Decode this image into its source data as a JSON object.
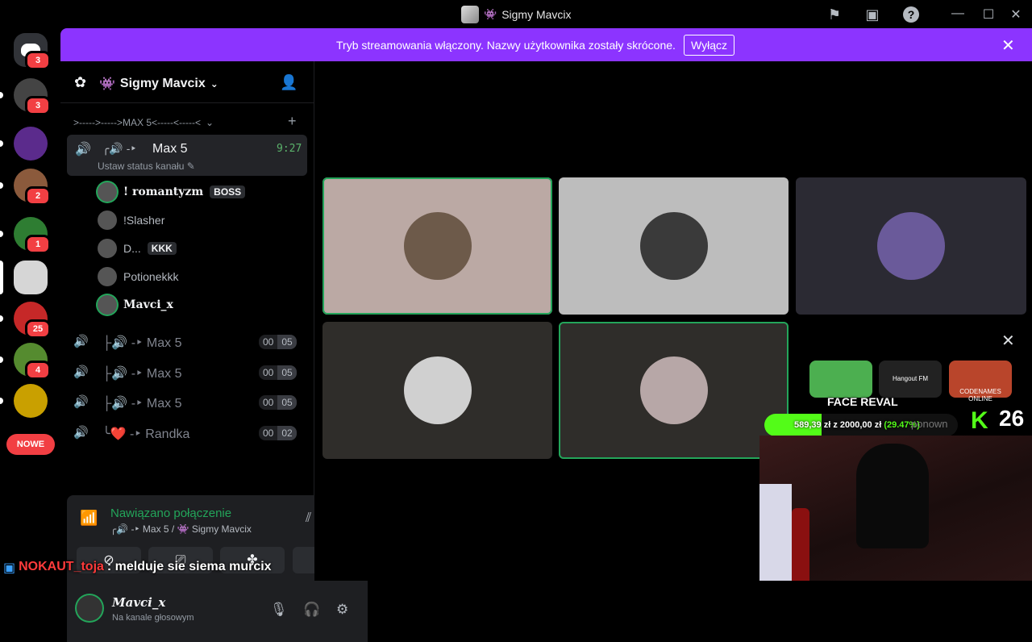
{
  "window": {
    "title": "Sigmy Mavcix",
    "title_emoji": "👾",
    "controls": [
      "—",
      "☐",
      "✕"
    ]
  },
  "rail": {
    "servers": [
      {
        "name": "home",
        "badge": "3"
      },
      {
        "name": "server-2",
        "badge": "3",
        "color": "#444"
      },
      {
        "name": "zakon",
        "badge": "",
        "color": "#5b2b8c"
      },
      {
        "name": "server-4",
        "badge": "2",
        "color": "#8b5a3c"
      },
      {
        "name": "pepe",
        "badge": "1",
        "color": "#2e7d32"
      },
      {
        "name": "server-6",
        "badge": "",
        "color": "#d6d6d6"
      },
      {
        "name": "server-7",
        "badge": "25",
        "color": "#c62828"
      },
      {
        "name": "server-8",
        "badge": "4",
        "color": "#558b2f"
      },
      {
        "name": "server-9",
        "badge": "",
        "color": "#c9a000"
      }
    ],
    "nowe_label": "NOWE"
  },
  "banner": {
    "text": "Tryb streamowania włączony. Nazwy użytkownika zostały skrócone.",
    "button": "Wyłącz"
  },
  "sidebar": {
    "server_name": "Sigmy Mavcix",
    "server_emoji": "👾",
    "category": ">----->----->MAX 5<-----<-----<",
    "active_channel": {
      "prefix": "╭🔊 -‣",
      "name": "Max 5",
      "timer": "9:27",
      "status": "Ustaw status kanału"
    },
    "members": [
      {
        "name": "! romantyzm",
        "tag": "BOSS",
        "speaking": true
      },
      {
        "name": "!Slasher",
        "tag": "",
        "speaking": false
      },
      {
        "name": "D...",
        "tag": "KKK",
        "speaking": false
      },
      {
        "name": "Potionekkk",
        "tag": "",
        "speaking": false
      },
      {
        "name": "Mavci_x",
        "tag": "",
        "speaking": true
      }
    ],
    "voice_channels": [
      {
        "prefix": "├🔊 -‣",
        "name": "Max 5",
        "count_a": "00",
        "count_b": "05"
      },
      {
        "prefix": "├🔊 -‣",
        "name": "Max 5",
        "count_a": "00",
        "count_b": "05"
      },
      {
        "prefix": "├🔊 -‣",
        "name": "Max 5",
        "count_a": "00",
        "count_b": "05"
      },
      {
        "prefix": "╰❤️ -‣",
        "name": "Randka",
        "count_a": "00",
        "count_b": "02"
      }
    ]
  },
  "voice_panel": {
    "title": "Nawiązano połączenie",
    "subtitle": "╭🔊 -‣ Max 5 / 👾 Sigmy Mavcix"
  },
  "user_panel": {
    "name": "Mavci_x",
    "status": "Na kanale głosowym"
  },
  "stage": {
    "tiles": [
      {
        "bg": "#bba9a4",
        "speaking": true,
        "avatar": "#6d5a4a"
      },
      {
        "bg": "#bdbdbd",
        "speaking": false,
        "avatar": "#3a3a3a"
      },
      {
        "bg": "#2b2a33",
        "speaking": false,
        "avatar": "#6a5a9a"
      },
      {
        "bg": "#2f2d2a",
        "speaking": false,
        "avatar": "#d0d0d0"
      },
      {
        "bg": "#2f2d2a",
        "speaking": true,
        "avatar": "#b7a7a7"
      }
    ]
  },
  "overlay": {
    "activities": [
      {
        "label": "",
        "color": "#4caf50"
      },
      {
        "label": "Hangout FM",
        "color": "#222"
      },
      {
        "label": "CODENAMES ONLINE",
        "color": "#b9452b"
      }
    ],
    "face_reveal": "FACE REVAL",
    "goal_current": "589,39 zł",
    "goal_sep": "z",
    "goal_target": "2000,00 zł",
    "goal_pct": "(29.47%)",
    "goal_fraction": 0.2947,
    "kick_logo": "K",
    "viewer_count": "26",
    "behind_text": "ponown"
  },
  "chat": {
    "user": "NOKAUT_toja",
    "message": ": melduje sie siema murcix"
  }
}
